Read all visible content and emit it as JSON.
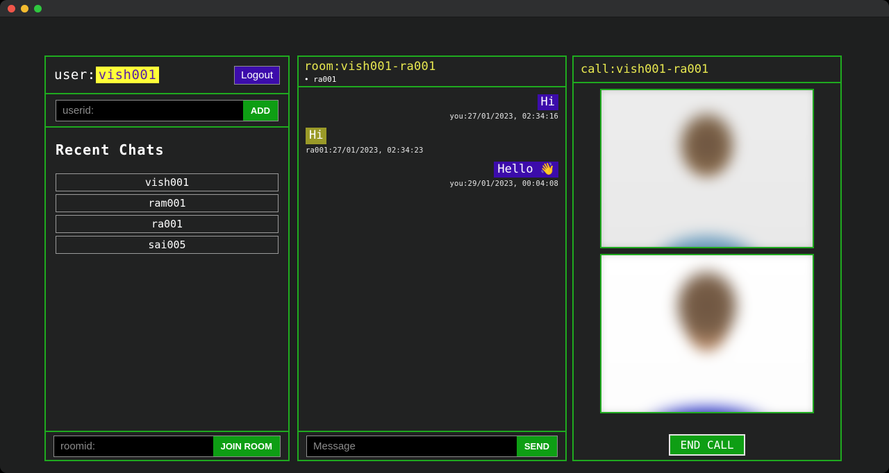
{
  "titlebar": {
    "buttons": [
      "close-button",
      "minimize-button",
      "zoom-button"
    ]
  },
  "left": {
    "user_prefix": "user:",
    "username": "vish001",
    "logout_label": "Logout",
    "add_user_placeholder": "userid:",
    "add_user_value": "",
    "add_label": "ADD",
    "recent_chats_title": "Recent Chats",
    "chats": [
      {
        "name": "vish001"
      },
      {
        "name": "ram001"
      },
      {
        "name": "ra001"
      },
      {
        "name": "sai005"
      }
    ],
    "room_placeholder": "roomid:",
    "room_value": "",
    "join_label": "JOIN ROOM"
  },
  "chat": {
    "room_title": "room:vish001-ra001",
    "members": "• ra001",
    "messages": [
      {
        "text": "Hi",
        "meta": "you:27/01/2023, 02:34:16",
        "direction": "out"
      },
      {
        "text": "Hi",
        "meta": "ra001:27/01/2023, 02:34:23",
        "direction": "in"
      },
      {
        "text": "Hello 👋",
        "meta": "you:29/01/2023, 00:04:08",
        "direction": "out"
      }
    ],
    "message_placeholder": "Message",
    "message_value": "",
    "send_label": "SEND"
  },
  "call": {
    "call_title": "call:vish001-ra001",
    "remote_video": "remote-video-feed",
    "local_video": "local-video-feed",
    "end_call_label": "END CALL"
  },
  "colors": {
    "accent_green": "#1faa1f",
    "button_green": "#0e9e14",
    "indigo": "#3c0cab",
    "yellow_highlight": "#ffff38",
    "title_yellow": "#e8e850",
    "olive_bubble": "#9a9a28",
    "panel_bg": "#212222",
    "app_bg": "#1e1f1f"
  }
}
